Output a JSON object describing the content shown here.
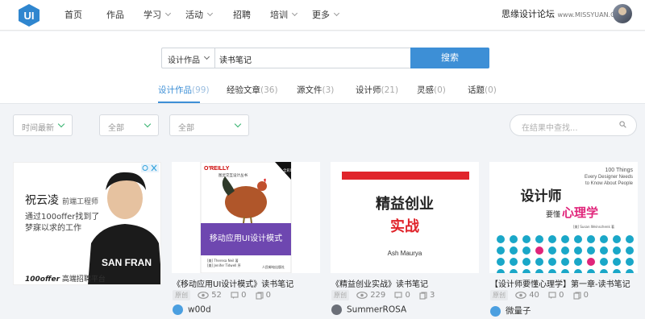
{
  "brand": {
    "logo_text": "UI",
    "accent": "#3d8fd6",
    "green": "#36b36f"
  },
  "nav": [
    {
      "label": "首页",
      "has_menu": false
    },
    {
      "label": "作品",
      "has_menu": false
    },
    {
      "label": "学习",
      "has_menu": true
    },
    {
      "label": "活动",
      "has_menu": true
    },
    {
      "label": "招聘",
      "has_menu": false
    },
    {
      "label": "培训",
      "has_menu": true
    },
    {
      "label": "更多",
      "has_menu": true
    }
  ],
  "watermark": {
    "text": "思缘设计论坛",
    "url": "www.MISSYUAN.COM"
  },
  "search": {
    "category": "设计作品",
    "query": "读书笔记",
    "button": "搜索"
  },
  "tabs": [
    {
      "label": "设计作品",
      "count": "(99)",
      "active": true
    },
    {
      "label": "经验文章",
      "count": "(36)",
      "active": false
    },
    {
      "label": "源文件",
      "count": "(3)",
      "active": false
    },
    {
      "label": "设计师",
      "count": "(21)",
      "active": false
    },
    {
      "label": "灵感",
      "count": "(0)",
      "active": false
    },
    {
      "label": "话题",
      "count": "(0)",
      "active": false
    }
  ],
  "filters": {
    "sort": "时间最新",
    "filter1": "全部",
    "filter2": "全部",
    "find_placeholder": "在结果中查找..."
  },
  "ad": {
    "name": "祝云凌",
    "role": "前端工程师",
    "line1": "通过100offer找到了",
    "line2": "梦寐以求的工作",
    "shirt": "SAN FRAN",
    "brand": "100offer",
    "slogan": "高端招聘平台"
  },
  "cards": [
    {
      "title": "《移动应用UI设计模式》读书笔记",
      "tag": "原创",
      "views": "52",
      "comments": "0",
      "favs": "0",
      "author": "w00d",
      "cover": {
        "publisher": "O'REILLY",
        "series": "图灵交互设计丛书",
        "book_title": "移动应用UI设计模式",
        "badge": "全彩印刷",
        "authors": "[美] Theresa Neil 著",
        "translator": "[美] Jenifer Tidwell 序",
        "press": "人民邮电出版社"
      }
    },
    {
      "title": "《精益创业实战》读书笔记",
      "tag": "原创",
      "views": "229",
      "comments": "0",
      "favs": "3",
      "author": "SummerROSA",
      "cover": {
        "line1": "精益创业",
        "line2": "实战",
        "author": "Ash Maurya"
      }
    },
    {
      "title": "【设计师要懂心理学】第一章-读书笔记",
      "tag": "原创",
      "views": "40",
      "comments": "0",
      "favs": "0",
      "author": "微量子",
      "cover": {
        "en1": "100 Things",
        "en2": "Every Designer Needs",
        "en3": "to Know About People",
        "cn1": "设计师",
        "cn2a": "要懂",
        "cn2b": "心理学",
        "author_line": "[美] Susan Weinschenk 著"
      }
    }
  ]
}
